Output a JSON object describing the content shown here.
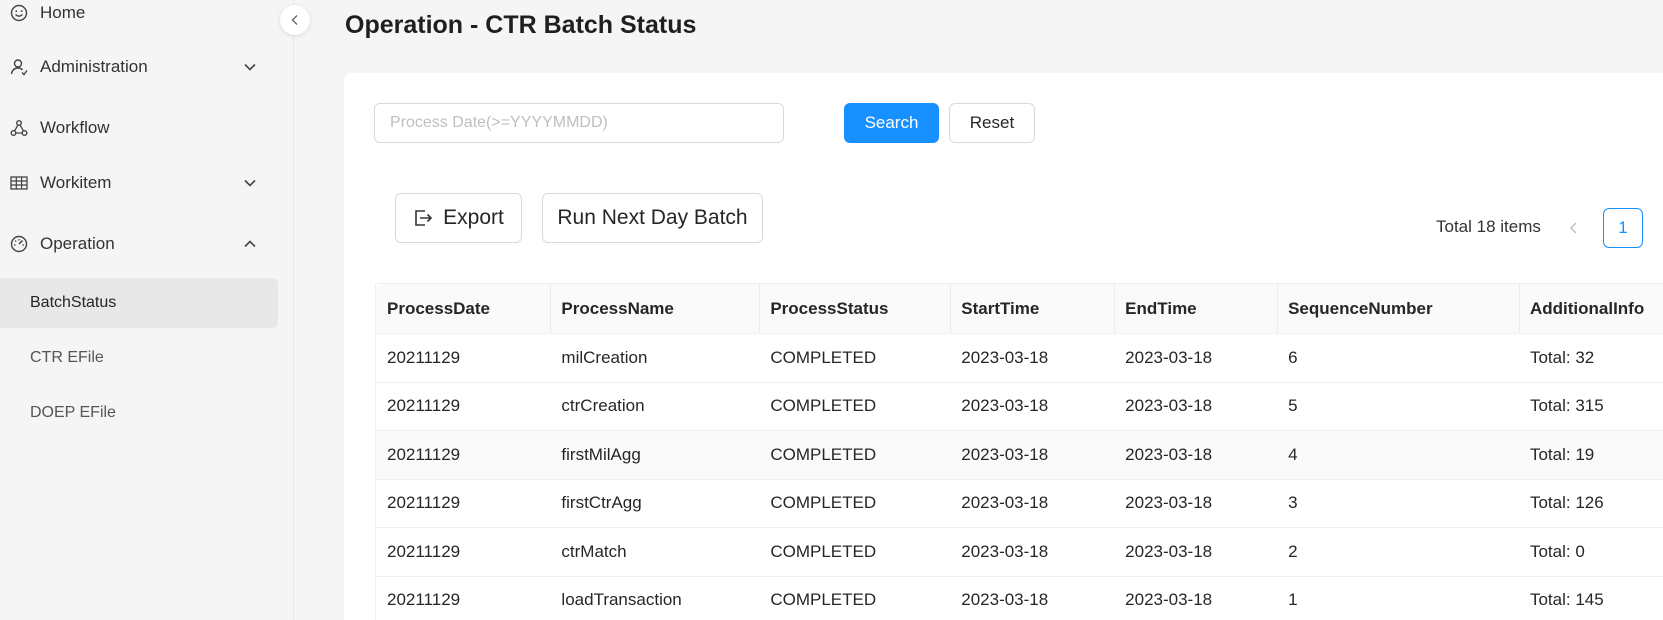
{
  "sidebar": {
    "items": [
      {
        "label": "Home",
        "icon": "smile-icon"
      },
      {
        "label": "Administration",
        "icon": "user-icon",
        "expanded": false
      },
      {
        "label": "Workflow",
        "icon": "workflow-icon"
      },
      {
        "label": "Workitem",
        "icon": "table-icon",
        "expanded": false
      },
      {
        "label": "Operation",
        "icon": "dashboard-icon",
        "expanded": true
      }
    ],
    "subitems": [
      {
        "label": "BatchStatus",
        "active": true
      },
      {
        "label": "CTR EFile",
        "active": false
      },
      {
        "label": "DOEP EFile",
        "active": false
      }
    ]
  },
  "page": {
    "title": "Operation - CTR Batch Status"
  },
  "filters": {
    "process_date_placeholder": "Process Date(>=YYYYMMDD)",
    "process_date_value": "",
    "search_label": "Search",
    "reset_label": "Reset"
  },
  "actions": {
    "export_label": "Export",
    "run_next_day_label": "Run Next Day Batch"
  },
  "pagination": {
    "total_text": "Total 18 items",
    "current_page": "1"
  },
  "table": {
    "columns": [
      "ProcessDate",
      "ProcessName",
      "ProcessStatus",
      "StartTime",
      "EndTime",
      "SequenceNumber",
      "AdditionalInfo"
    ],
    "rows": [
      [
        "20211129",
        "milCreation",
        "COMPLETED",
        "2023-03-18",
        "2023-03-18",
        "6",
        "Total: 32"
      ],
      [
        "20211129",
        "ctrCreation",
        "COMPLETED",
        "2023-03-18",
        "2023-03-18",
        "5",
        "Total: 315"
      ],
      [
        "20211129",
        "firstMilAgg",
        "COMPLETED",
        "2023-03-18",
        "2023-03-18",
        "4",
        "Total: 19"
      ],
      [
        "20211129",
        "firstCtrAgg",
        "COMPLETED",
        "2023-03-18",
        "2023-03-18",
        "3",
        "Total: 126"
      ],
      [
        "20211129",
        "ctrMatch",
        "COMPLETED",
        "2023-03-18",
        "2023-03-18",
        "2",
        "Total: 0"
      ],
      [
        "20211129",
        "loadTransaction",
        "COMPLETED",
        "2023-03-18",
        "2023-03-18",
        "1",
        "Total: 145"
      ]
    ]
  },
  "colors": {
    "primary": "#1890ff",
    "sidebar_bg": "#f5f5f5",
    "active_item_bg": "#e8e8e8",
    "header_bg": "#fafafa"
  }
}
